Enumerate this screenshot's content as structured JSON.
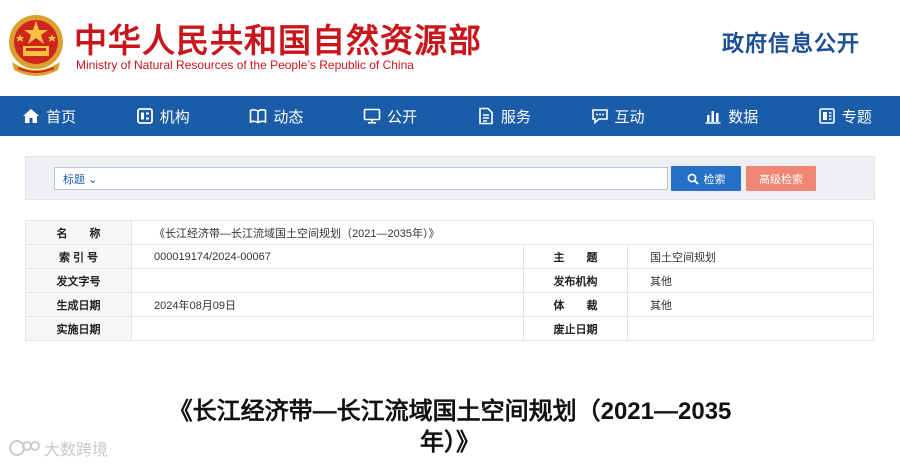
{
  "header": {
    "title_cn": "中华人民共和国自然资源部",
    "title_en": "Ministry of Natural Resources of the People’s Republic of China",
    "gov_open": "政府信息公开"
  },
  "nav": {
    "items": [
      {
        "label": "首页",
        "icon": "home-icon"
      },
      {
        "label": "机构",
        "icon": "org-icon"
      },
      {
        "label": "动态",
        "icon": "book-icon"
      },
      {
        "label": "公开",
        "icon": "monitor-icon"
      },
      {
        "label": "服务",
        "icon": "document-icon"
      },
      {
        "label": "互动",
        "icon": "chat-icon"
      },
      {
        "label": "数据",
        "icon": "bar-chart-icon"
      },
      {
        "label": "专题",
        "icon": "topic-icon"
      }
    ]
  },
  "search": {
    "type_label": "标题",
    "placeholder": "",
    "search_button": "检索",
    "advanced_button": "高级检索"
  },
  "info": {
    "name_label": "名　　称",
    "name_value": "《长江经济带—长江流域国土空间规划（2021—2035年）》",
    "index_label": "索 引 号",
    "index_value": "000019174/2024-00067",
    "subject_label": "主　　题",
    "subject_value": "国土空间规划",
    "docno_label": "发文字号",
    "docno_value": "",
    "issuer_label": "发布机构",
    "issuer_value": "其他",
    "date_label": "生成日期",
    "date_value": "2024年08月09日",
    "genre_label": "体　　裁",
    "genre_value": "其他",
    "impl_label": "实施日期",
    "impl_value": "",
    "expiry_label": "废止日期",
    "expiry_value": ""
  },
  "document": {
    "title_line1": "《长江经济带—长江流域国土空间规划（2021—2035",
    "title_line2": "年）》"
  },
  "watermark": {
    "text": "大数跨境"
  },
  "colors": {
    "brand_red": "#c8161d",
    "nav_blue": "#1b5ca8",
    "search_blue": "#2670c7",
    "advanced_salmon": "#f08774"
  }
}
